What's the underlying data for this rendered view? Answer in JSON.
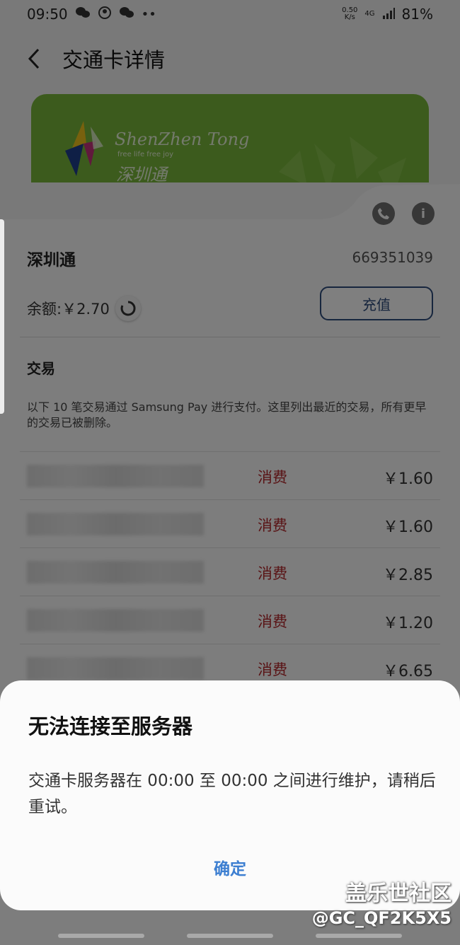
{
  "status_bar": {
    "time": "09:50",
    "speed_top": "0.50",
    "speed_unit": "K/s",
    "network": "4G",
    "battery": "81%"
  },
  "header": {
    "title": "交通卡详情"
  },
  "card_art": {
    "brand": "ShenZhen Tong",
    "tagline": "free life free joy",
    "cn_name": "深圳通"
  },
  "card_info": {
    "name": "深圳通",
    "number": "669351039",
    "balance": "余额:￥2.70",
    "recharge_label": "充值"
  },
  "transactions": {
    "title": "交易",
    "note": "以下 10 笔交易通过 Samsung Pay 进行支付。这里列出最近的交易，所有更早的交易已被删除。",
    "rows": [
      {
        "type": "消费",
        "amount": "￥1.60"
      },
      {
        "type": "消费",
        "amount": "￥1.60"
      },
      {
        "type": "消费",
        "amount": "￥2.85"
      },
      {
        "type": "消费",
        "amount": "￥1.20"
      },
      {
        "type": "消费",
        "amount": "￥6.65"
      }
    ]
  },
  "dialog": {
    "title": "无法连接至服务器",
    "message": "交通卡服务器在 00:00 至 00:00 之间进行维护，请稍后重试。",
    "ok_label": "确定"
  },
  "watermark": {
    "line1": "盖乐世社区",
    "line2": "@GC_QF2K5X5"
  },
  "colors": {
    "card_green": "#78b63a",
    "accent_blue": "#3d7fd1",
    "expense_red": "#b3262a",
    "button_border": "#2e4c7c"
  }
}
